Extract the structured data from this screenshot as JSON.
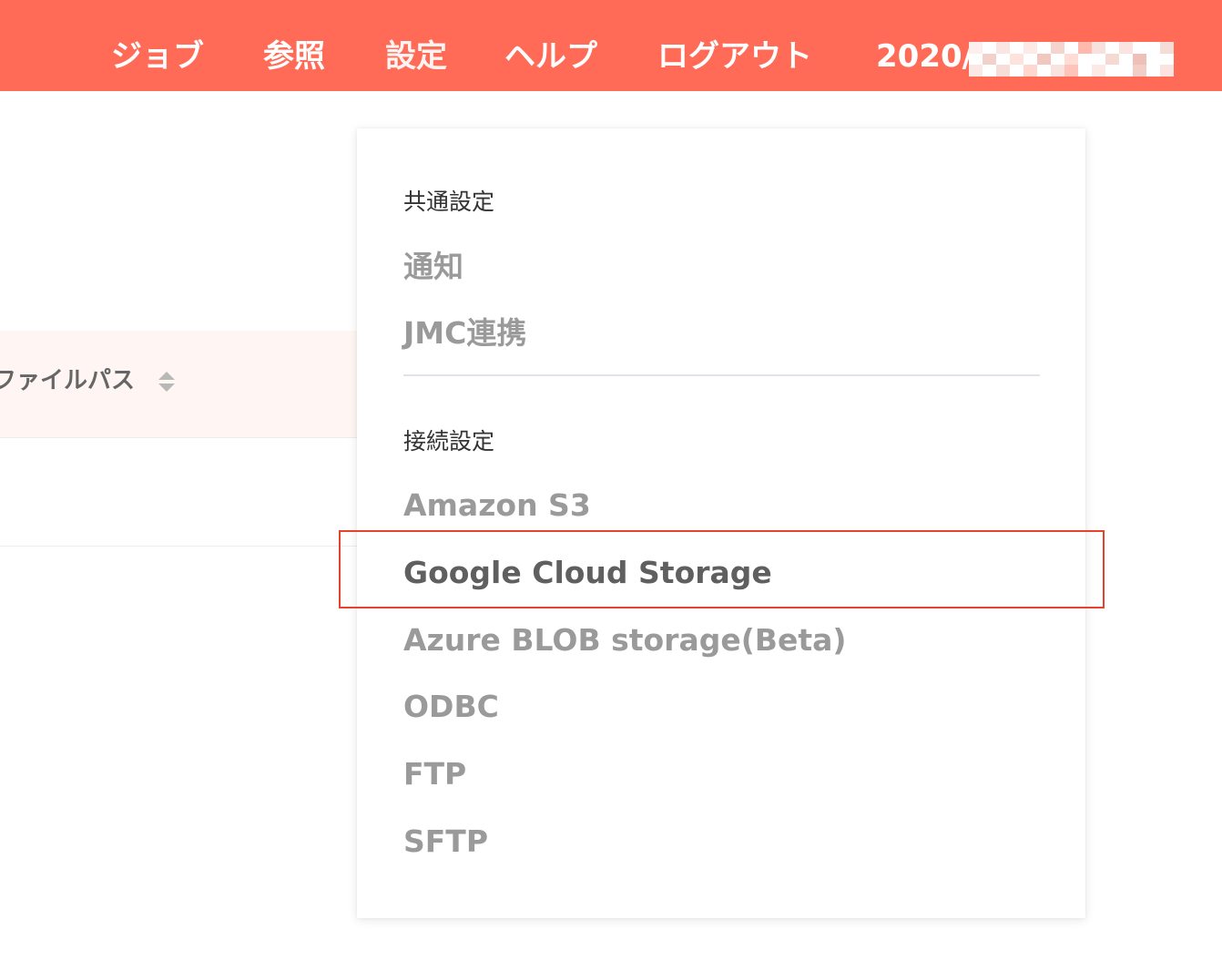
{
  "header": {
    "nav": [
      {
        "label": "ジョブ"
      },
      {
        "label": "参照"
      },
      {
        "label": "設定"
      },
      {
        "label": "ヘルプ"
      },
      {
        "label": "ログアウト"
      }
    ],
    "date_prefix": "2020/"
  },
  "table": {
    "column_header": "ファイルパス"
  },
  "settings_menu": {
    "sections": [
      {
        "label": "共通設定",
        "items": [
          {
            "label": "通知"
          },
          {
            "label": "JMC連携"
          }
        ]
      },
      {
        "label": "接続設定",
        "items": [
          {
            "label": "Amazon S3"
          },
          {
            "label": "Google Cloud Storage"
          },
          {
            "label": "Azure BLOB storage(Beta)"
          },
          {
            "label": "ODBC"
          },
          {
            "label": "FTP"
          },
          {
            "label": "SFTP"
          }
        ]
      }
    ]
  },
  "colors": {
    "header_bg": "#ff6b57",
    "highlight_border": "#e8412c",
    "menu_item": "#9a9a9a",
    "menu_item_active": "#5f5f5f"
  }
}
